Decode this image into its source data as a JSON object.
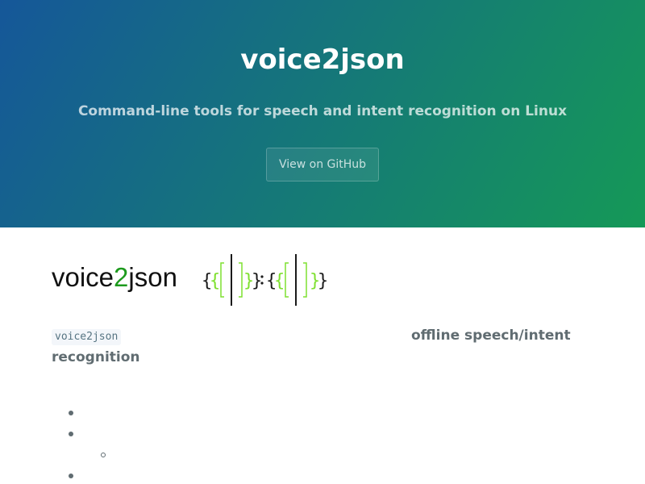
{
  "header": {
    "title": "voice2json",
    "tagline": "Command-line tools for speech and intent recognition on Linux",
    "github_button": "View on GitHub"
  },
  "logo": {
    "text_prefix": "voice",
    "text_accent": "2",
    "text_suffix": "json",
    "icon": "braces-waveform-icon"
  },
  "intro": {
    "code": "voice2json",
    "highlight_right": "offline speech/intent",
    "highlight_left": "recognition"
  },
  "list": {
    "bullets": [
      "filled",
      "filled",
      "hollow",
      "filled"
    ]
  },
  "colors": {
    "header_gradient_start": "#155799",
    "header_gradient_end": "#159957",
    "logo_accent": "#1d9a1d",
    "body_text": "#606c71"
  }
}
